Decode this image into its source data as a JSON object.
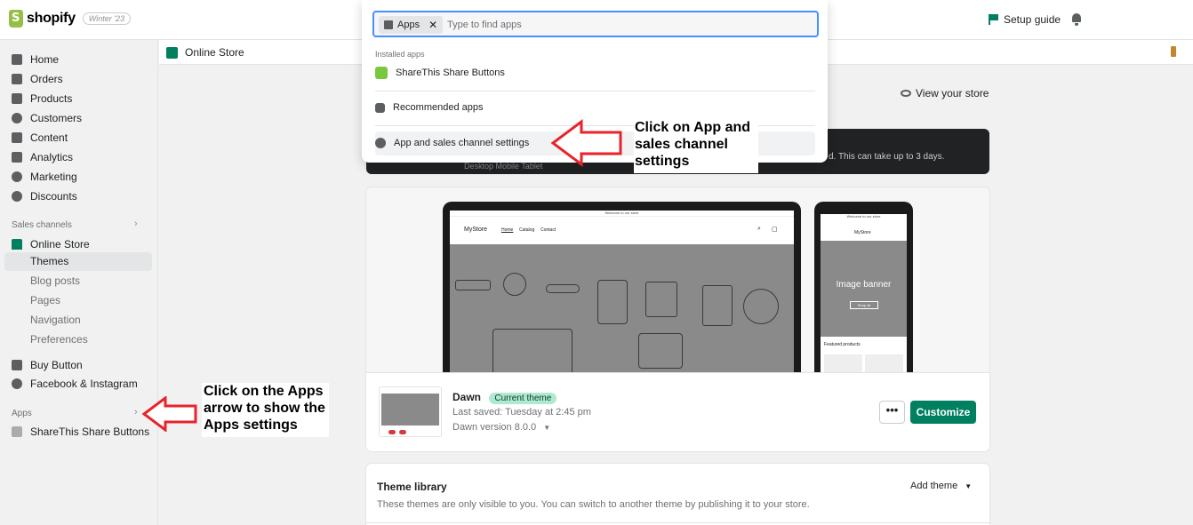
{
  "topbar": {
    "logo_text": "shopify",
    "edition_badge": "Winter '23",
    "setup_guide": "Setup guide"
  },
  "sidebar": {
    "main_items": [
      {
        "label": "Home",
        "icon": "home-icon"
      },
      {
        "label": "Orders",
        "icon": "orders-icon"
      },
      {
        "label": "Products",
        "icon": "tag-icon"
      },
      {
        "label": "Customers",
        "icon": "person-icon"
      },
      {
        "label": "Content",
        "icon": "content-icon"
      },
      {
        "label": "Analytics",
        "icon": "chart-icon"
      },
      {
        "label": "Marketing",
        "icon": "target-icon"
      },
      {
        "label": "Discounts",
        "icon": "discount-icon"
      }
    ],
    "sales_channels_label": "Sales channels",
    "online_store": "Online Store",
    "online_store_sub": [
      "Themes",
      "Blog posts",
      "Pages",
      "Navigation",
      "Preferences"
    ],
    "buy_button": "Buy Button",
    "facebook": "Facebook & Instagram",
    "apps_label": "Apps",
    "share_this": "ShareThis Share Buttons"
  },
  "breadcrumb": {
    "title": "Online Store"
  },
  "main": {
    "view_store": "View your store",
    "banner_text": "d. This can take up to 3 days.",
    "banner_tabs": "Desktop          Mobile          Tablet"
  },
  "preview": {
    "laptop_announcement": "Welcome to our store",
    "laptop_store": "MyStore",
    "laptop_nav": [
      "Home",
      "Catalog",
      "Contact"
    ],
    "phone_announcement": "Welcome to our store",
    "phone_store": "MyStore",
    "phone_banner_title": "Image banner",
    "phone_shop_all": "Shop all",
    "phone_featured": "Featured products"
  },
  "theme": {
    "name": "Dawn",
    "badge": "Current theme",
    "last_saved": "Last saved: Tuesday at 2:45 pm",
    "version": "Dawn version 8.0.0",
    "more_label": "•••",
    "customize_label": "Customize"
  },
  "library": {
    "title": "Theme library",
    "description": "These themes are only visible to you. You can switch to another theme by publishing it to your store.",
    "add_theme": "Add theme"
  },
  "popover": {
    "chip_label": "Apps",
    "chip_close": "✕",
    "search_placeholder": "Type to find apps",
    "installed_label": "Installed apps",
    "installed_app": "ShareThis Share Buttons",
    "recommended": "Recommended apps",
    "settings": "App and sales channel settings"
  },
  "annotations": {
    "settings_note_lines": [
      "Click on App and",
      "sales channel",
      "settings"
    ],
    "apps_note_lines": [
      "Click on the Apps",
      "arrow to show the",
      "Apps settings"
    ],
    "arrow_color": "#e8232a"
  }
}
